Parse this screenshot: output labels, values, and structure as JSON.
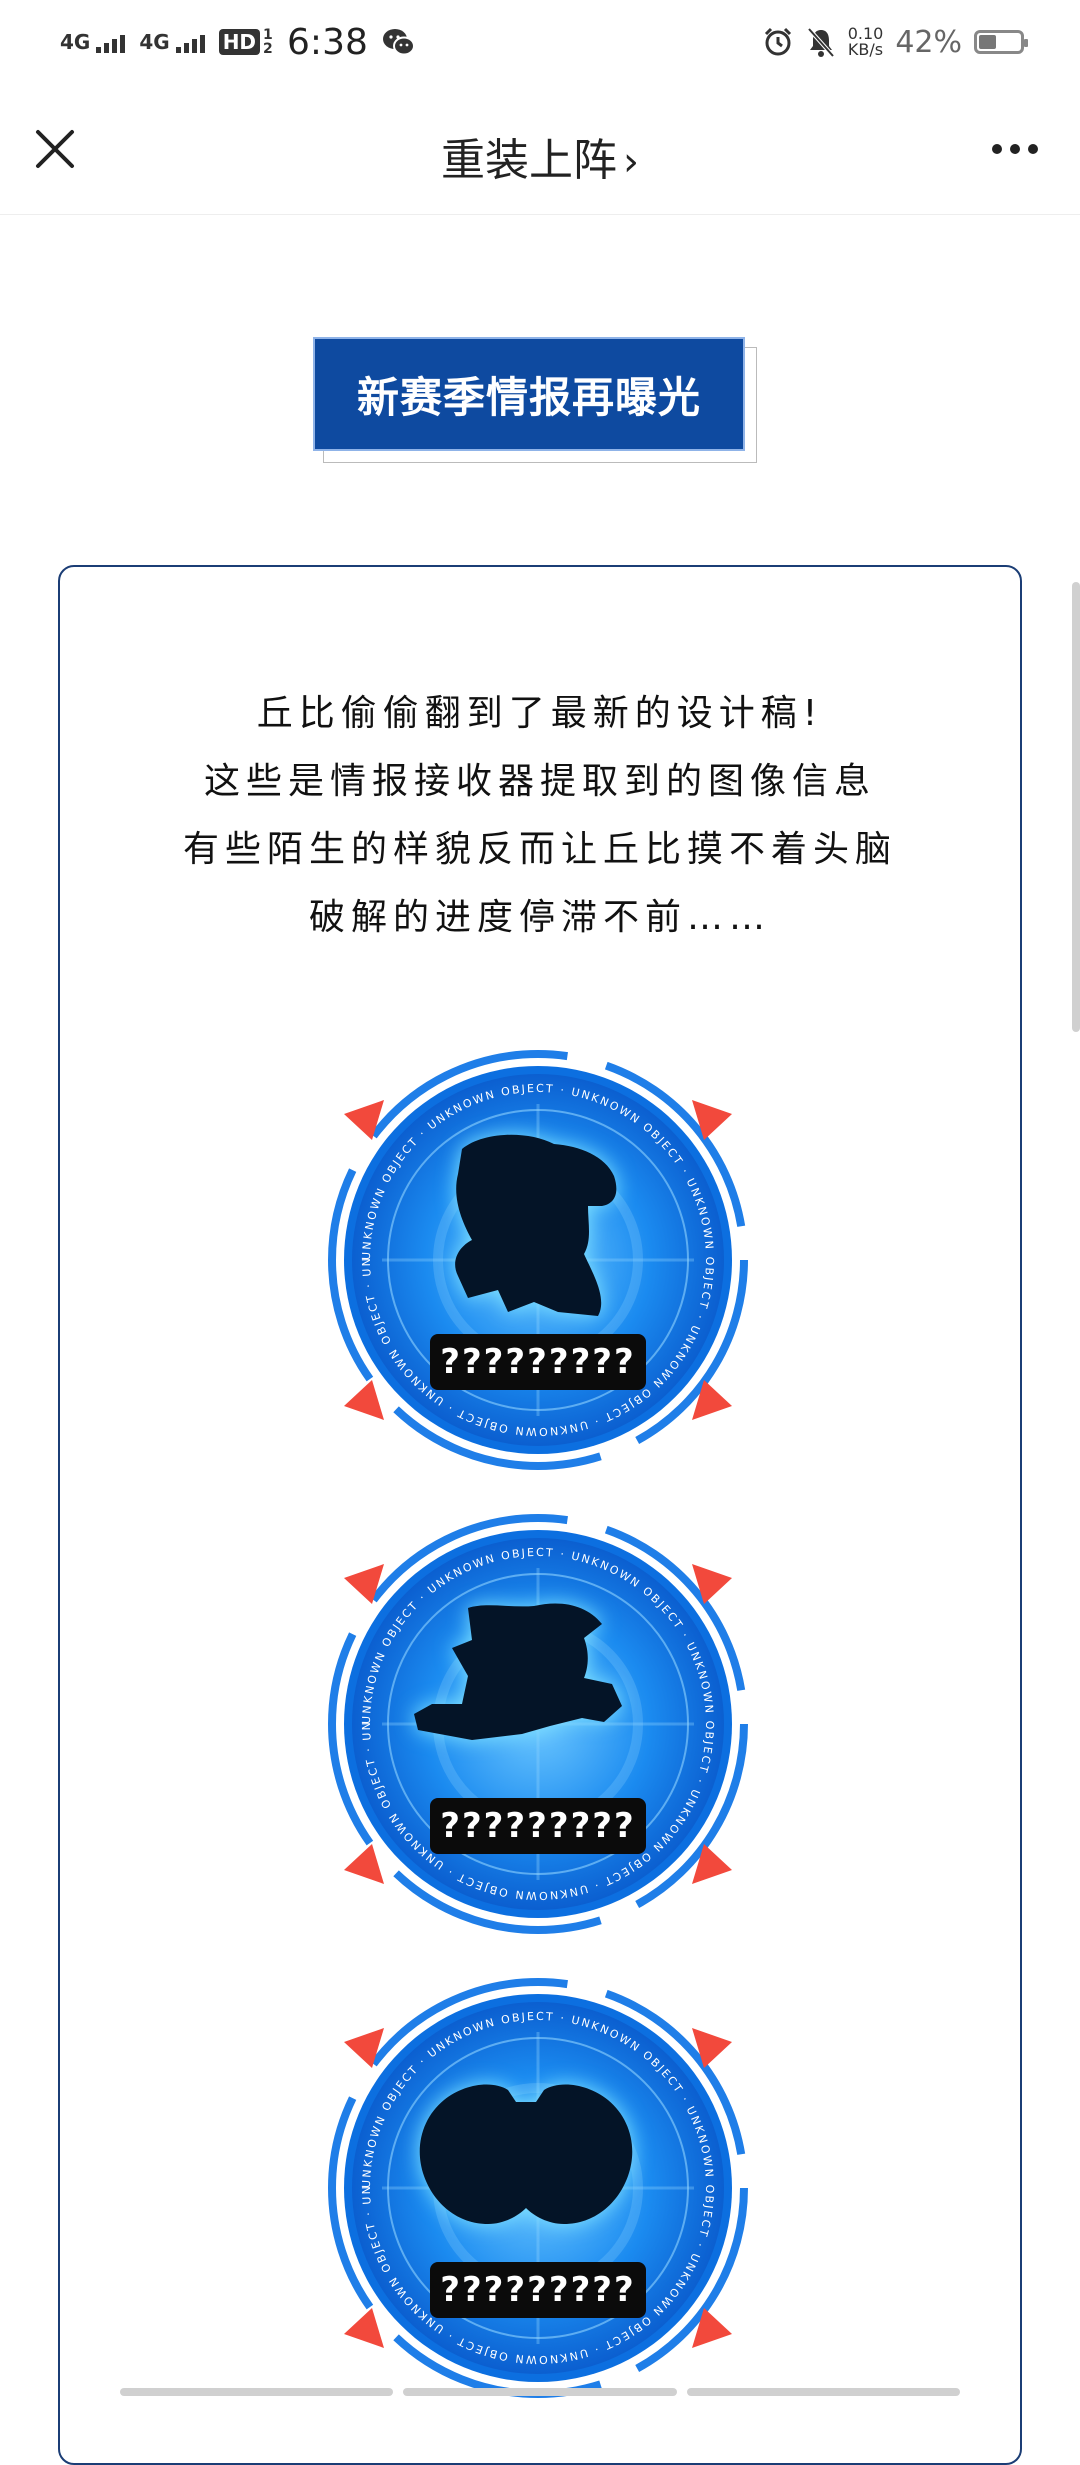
{
  "status_bar": {
    "sig1": "4G",
    "sig2": "4G",
    "hd": "HD",
    "hd_sub": "1 2",
    "time": "6:38",
    "net_speed_value": "0.10",
    "net_speed_unit": "KB/s",
    "battery_pct": "42%",
    "battery_level": 0.42
  },
  "header": {
    "title": "重装上阵",
    "chevron": "›"
  },
  "banner": {
    "text": "新赛季情报再曝光"
  },
  "intro": {
    "lines": [
      "丘比偷偷翻到了最新的设计稿!",
      "这些是情报接收器提取到的图像信息",
      "有些陌生的样貌反而让丘比摸不着头脑",
      "破解的进度停滞不前……"
    ]
  },
  "ring_text": "UNKNOWN OBJECT · UNKNOWN OBJECT · UNKNOWN OBJECT · UNKNOWN OBJECT · ",
  "units": [
    {
      "label": "?????????",
      "silhouette": "robot-silhouette"
    },
    {
      "label": "?????????",
      "silhouette": "vehicle-silhouette"
    },
    {
      "label": "?????????",
      "silhouette": "round-silhouette"
    }
  ],
  "colors": {
    "banner_bg": "#0e4aa0",
    "card_border": "#1b3d75",
    "ring_blue": "#1a8ff0",
    "arrow_red": "#f2493c"
  }
}
